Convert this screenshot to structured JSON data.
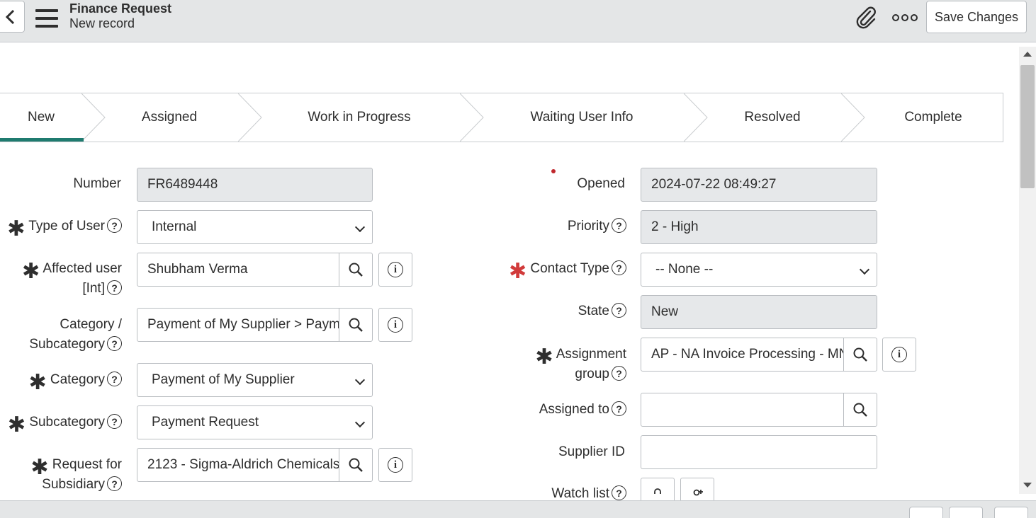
{
  "header": {
    "title": "Finance Request",
    "subtitle": "New record",
    "back_icon": "chevron-left-icon",
    "menu_icon": "hamburger-icon",
    "attachment_icon": "paperclip-icon",
    "more_icon": "more-options-icon",
    "save_label": "Save Changes"
  },
  "process_flow": {
    "active_color": "#1f7b6f",
    "steps": [
      {
        "label": "New",
        "active": true
      },
      {
        "label": "Assigned",
        "active": false
      },
      {
        "label": "Work in Progress",
        "active": false
      },
      {
        "label": "Waiting User Info",
        "active": false
      },
      {
        "label": "Resolved",
        "active": false
      },
      {
        "label": "Complete",
        "active": false
      }
    ]
  },
  "form": {
    "left": {
      "number": {
        "label": "Number",
        "value": "FR6489448"
      },
      "type_of_user": {
        "label": "Type of User",
        "value": "Internal",
        "required": true
      },
      "affected_user": {
        "label_line1": "Affected user",
        "label_line2": "[Int]",
        "value": "Shubham Verma",
        "required": true
      },
      "category_subcategory": {
        "label_line1": "Category /",
        "label_line2": "Subcategory",
        "value": "Payment of My Supplier > Paym"
      },
      "category": {
        "label": "Category",
        "value": "Payment of My Supplier",
        "required": true
      },
      "subcategory": {
        "label": "Subcategory",
        "value": "Payment Request",
        "required": true
      },
      "request_for_subsidiary": {
        "label_line1": "Request for",
        "label_line2": "Subsidiary",
        "value": "2123 - Sigma-Aldrich Chemicals",
        "required": true
      }
    },
    "right": {
      "opened": {
        "label": "Opened",
        "value": "2024-07-22 08:49:27"
      },
      "priority": {
        "label": "Priority",
        "value": "2 - High"
      },
      "contact_type": {
        "label": "Contact Type",
        "value": "-- None --",
        "required": true,
        "required_color": "#d13b3b"
      },
      "state": {
        "label": "State",
        "value": "New"
      },
      "assignment_group": {
        "label_line1": "Assignment",
        "label_line2": "group",
        "value": "AP - NA Invoice Processing - MN",
        "required": true
      },
      "assigned_to": {
        "label": "Assigned to",
        "value": ""
      },
      "supplier_id": {
        "label": "Supplier ID",
        "value": ""
      },
      "watch_list": {
        "label": "Watch list"
      }
    }
  },
  "icons": {
    "required": "asterisk-icon",
    "help": "question-circle-icon",
    "search": "search-icon",
    "info": "info-icon",
    "lock": "lock-icon",
    "add_user": "add-me-icon"
  },
  "colors": {
    "header_bg": "#e4e6e7",
    "readonly_bg": "#e6e8ea",
    "accent": "#1f7b6f"
  }
}
